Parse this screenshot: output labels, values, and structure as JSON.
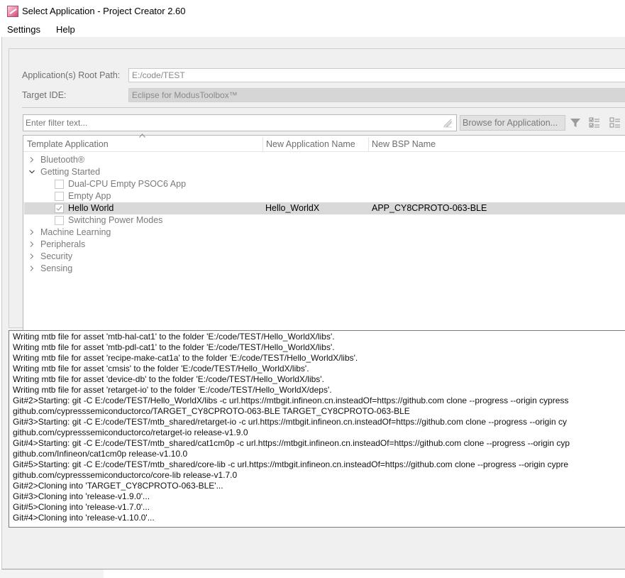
{
  "window": {
    "title": "Select Application - Project Creator 2.60"
  },
  "menu": {
    "items": [
      "Settings",
      "Help"
    ]
  },
  "form": {
    "root_path_label": "Application(s) Root Path:",
    "root_path_value": "E:/code/TEST",
    "target_ide_label": "Target IDE:",
    "target_ide_value": "Eclipse for ModusToolbox™"
  },
  "filter": {
    "placeholder": "Enter filter text...",
    "browse_label": "Browse for Application..."
  },
  "tree": {
    "columns": [
      "Template Application",
      "New Application Name",
      "New BSP Name"
    ],
    "rows": [
      {
        "label": "Bluetooth®",
        "type": "category",
        "expanded": false
      },
      {
        "label": "Getting Started",
        "type": "category",
        "expanded": true
      },
      {
        "label": "Dual-CPU Empty PSOC6 App",
        "type": "app",
        "checked": false
      },
      {
        "label": "Empty App",
        "type": "app",
        "checked": false
      },
      {
        "label": "Hello World",
        "type": "app",
        "checked": true,
        "app_name": "Hello_WorldX",
        "bsp_name": "APP_CY8CPROTO-063-BLE"
      },
      {
        "label": "Switching Power Modes",
        "type": "app",
        "checked": false
      },
      {
        "label": "Machine Learning",
        "type": "category",
        "expanded": false
      },
      {
        "label": "Peripherals",
        "type": "category",
        "expanded": false
      },
      {
        "label": "Security",
        "type": "category",
        "expanded": false
      },
      {
        "label": "Sensing",
        "type": "category",
        "expanded": false
      }
    ]
  },
  "log": {
    "lines": [
      "Writing mtb file for asset 'mtb-hal-cat1' to the folder 'E:/code/TEST/Hello_WorldX/libs'.",
      "Writing mtb file for asset 'mtb-pdl-cat1' to the folder 'E:/code/TEST/Hello_WorldX/libs'.",
      "Writing mtb file for asset 'recipe-make-cat1a' to the folder 'E:/code/TEST/Hello_WorldX/libs'.",
      "Writing mtb file for asset 'cmsis' to the folder 'E:/code/TEST/Hello_WorldX/libs'.",
      "Writing mtb file for asset 'device-db' to the folder 'E:/code/TEST/Hello_WorldX/libs'.",
      "Writing mtb file for asset 'retarget-io' to the folder 'E:/code/TEST/Hello_WorldX/deps'.",
      "Git#2>Starting: git -C E:/code/TEST/Hello_WorldX/libs -c url.https://mtbgit.infineon.cn.insteadOf=https://github.com clone --progress --origin cypress",
      "github.com/cypresssemiconductorco/TARGET_CY8CPROTO-063-BLE TARGET_CY8CPROTO-063-BLE",
      "Git#3>Starting: git -C E:/code/TEST/mtb_shared/retarget-io -c url.https://mtbgit.infineon.cn.insteadOf=https://github.com clone --progress --origin cy",
      "github.com/cypresssemiconductorco/retarget-io release-v1.9.0",
      "Git#4>Starting: git -C E:/code/TEST/mtb_shared/cat1cm0p -c url.https://mtbgit.infineon.cn.insteadOf=https://github.com clone --progress --origin cyp",
      "github.com/Infineon/cat1cm0p release-v1.10.0",
      "Git#5>Starting: git -C E:/code/TEST/mtb_shared/core-lib -c url.https://mtbgit.infineon.cn.insteadOf=https://github.com clone --progress --origin cypre",
      "github.com/cypresssemiconductorco/core-lib release-v1.7.0",
      "Git#2>Cloning into 'TARGET_CY8CPROTO-063-BLE'...",
      "Git#3>Cloning into 'release-v1.9.0'...",
      "Git#5>Cloning into 'release-v1.7.0'...",
      "Git#4>Cloning into 'release-v1.10.0'..."
    ]
  },
  "icons": {
    "app": "project-creator-icon",
    "clear": "eraser-icon",
    "filter": "funnel-filter-icon",
    "select_all": "select-all-icon",
    "deselect_all": "deselect-all-icon",
    "collapse": "collapse-icon"
  },
  "colors": {
    "selected_row": "#d9d9d9",
    "window_bg": "#f0f0f0",
    "disabled_text": "#7a7a7a"
  }
}
